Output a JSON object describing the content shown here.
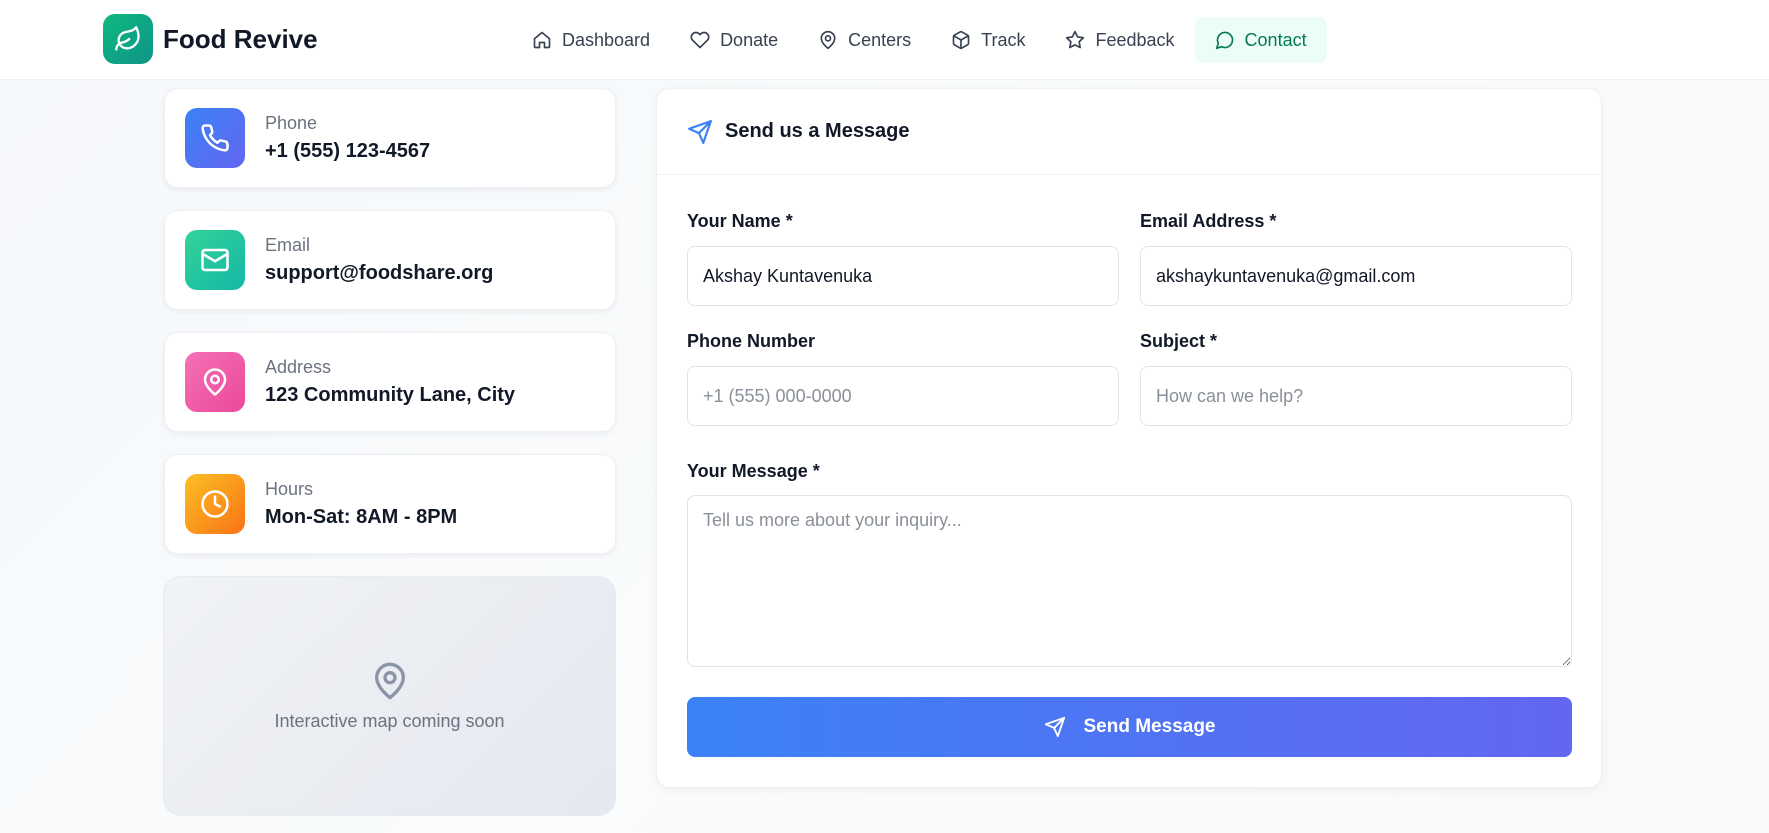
{
  "brand": {
    "name": "Food Revive",
    "accent": "#10b981"
  },
  "nav": {
    "items": [
      {
        "label": "Dashboard",
        "icon": "home-icon"
      },
      {
        "label": "Donate",
        "icon": "heart-icon"
      },
      {
        "label": "Centers",
        "icon": "map-pin-icon"
      },
      {
        "label": "Track",
        "icon": "package-icon"
      },
      {
        "label": "Feedback",
        "icon": "star-icon"
      },
      {
        "label": "Contact",
        "icon": "message-circle-icon",
        "active": true
      }
    ]
  },
  "contact_info": [
    {
      "label": "Phone",
      "value": "+1 (555) 123-4567",
      "icon": "phone-icon",
      "color": "#6366f1"
    },
    {
      "label": "Email",
      "value": "support@foodshare.org",
      "icon": "mail-icon",
      "color": "#10b981"
    },
    {
      "label": "Address",
      "value": "123 Community Lane, City",
      "icon": "map-pin-icon",
      "color": "#ec4899"
    },
    {
      "label": "Hours",
      "value": "Mon-Sat: 8AM - 8PM",
      "icon": "clock-icon",
      "color": "#f97316"
    }
  ],
  "map": {
    "text": "Interactive map coming soon",
    "icon": "map-pin-icon"
  },
  "form": {
    "title": "Send us a Message",
    "name_label": "Your Name *",
    "name_value": "Akshay Kuntavenuka",
    "email_label": "Email Address *",
    "email_value": "akshaykuntavenuka@gmail.com",
    "phone_label": "Phone Number",
    "phone_placeholder": "+1 (555) 000-0000",
    "subject_label": "Subject *",
    "subject_placeholder": "How can we help?",
    "message_label": "Your Message *",
    "message_placeholder": "Tell us more about your inquiry...",
    "submit_label": "Send Message",
    "submit_color": "#3b82f6"
  }
}
